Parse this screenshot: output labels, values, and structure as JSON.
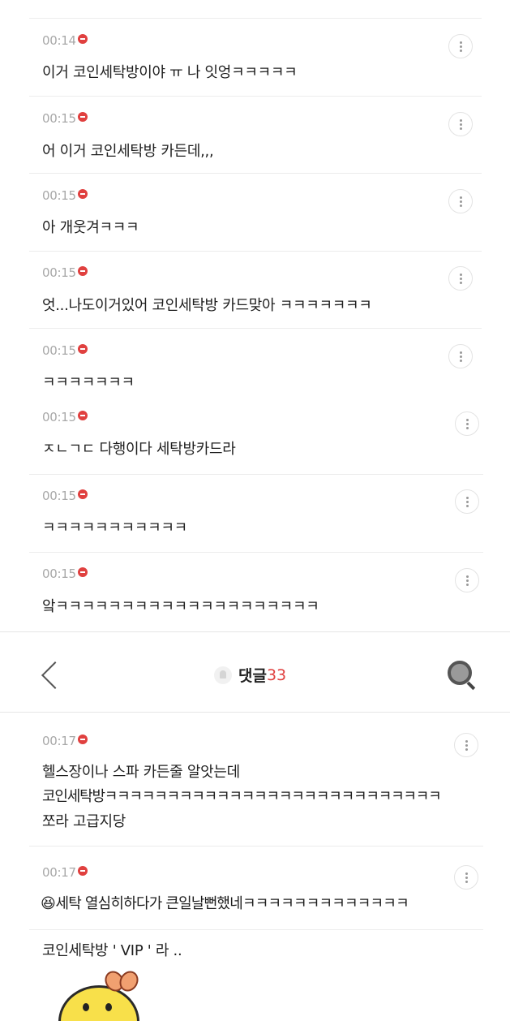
{
  "comments_top": [
    {
      "time": "00:14",
      "text": "이거 코인세탁방이야 ㅠ 나 잇엉ㅋㅋㅋㅋㅋ"
    },
    {
      "time": "00:15",
      "text": "어 이거 코인세탁방 카든데,,,"
    },
    {
      "time": "00:15",
      "text": "아 개웃겨ㅋㅋㅋ"
    },
    {
      "time": "00:15",
      "text": "엇...나도이거있어 코인세탁방 카드맞아 ㅋㅋㅋㅋㅋㅋㅋ"
    },
    {
      "time": "00:15",
      "text": "ㅋㅋㅋㅋㅋㅋㅋ"
    },
    {
      "time": "00:15",
      "text": "ㅈㄴㄱㄷ 다행이다 세탁방카드라"
    },
    {
      "time": "00:15",
      "text": "ㅋㅋㅋㅋㅋㅋㅋㅋㅋㅋㅋ"
    },
    {
      "time": "00:15",
      "text": "앜ㅋㅋㅋㅋㅋㅋㅋㅋㅋㅋㅋㅋㅋㅋㅋㅋㅋㅋㅋㅋ"
    }
  ],
  "header": {
    "title": "댓글",
    "count": "33"
  },
  "comments_bottom": [
    {
      "time": "00:17",
      "lines": [
        "헬스장이나 스파 카든줄 알앗는데",
        "코인세탁방ㅋㅋㅋㅋㅋㅋㅋㅋㅋㅋㅋㅋㅋㅋㅋㅋㅋㅋㅋㅋㅋㅋㅋㅋㅋㅋㅋ",
        "쪼라 고급지당"
      ]
    },
    {
      "time": "00:17",
      "emoji": "😆",
      "text": "세탁 열심히하다가 큰일날뻔했네ㅋㅋㅋㅋㅋㅋㅋㅋㅋㅋㅋㅋㅋ"
    },
    {
      "text": "코인세탁방 ' VIP ' 라 .."
    }
  ],
  "colors": {
    "accent": "#e0403f",
    "time": "#a8a8a8",
    "text": "#1e1e1e"
  }
}
